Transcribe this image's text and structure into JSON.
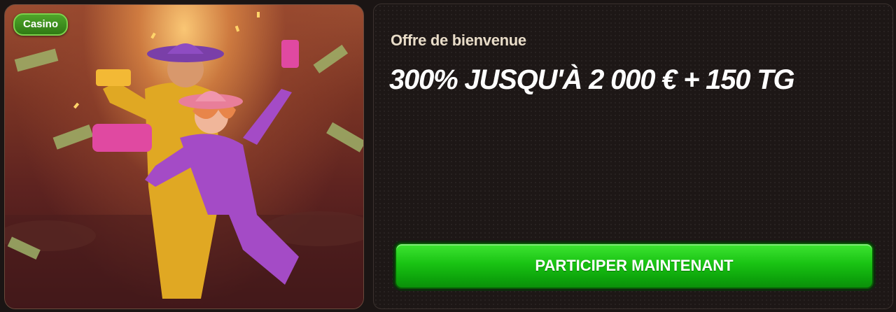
{
  "promo_image": {
    "badge": "Casino",
    "colors": {
      "badge": "#3a8c1c",
      "glow": "#ffcd78"
    }
  },
  "offer": {
    "label": "Offre de bienvenue",
    "title": "300% JUSQU'À 2 000 € + 150 TG",
    "cta_label": "PARTICIPER MAINTENANT",
    "colors": {
      "cta": "#19c313",
      "card": "#1d1716"
    }
  }
}
